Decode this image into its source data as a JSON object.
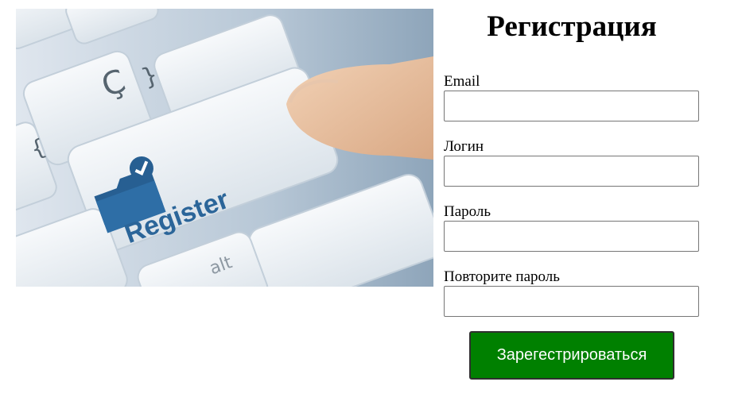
{
  "hero_image": {
    "alt": "Register",
    "key_text": "Register",
    "alt_key_text": "alt"
  },
  "form": {
    "title": "Регистрация",
    "fields": [
      {
        "label": "Email",
        "value": "",
        "type": "email"
      },
      {
        "label": "Логин",
        "value": "",
        "type": "text"
      },
      {
        "label": "Пароль",
        "value": "",
        "type": "password"
      },
      {
        "label": "Повторите пароль",
        "value": "",
        "type": "password"
      }
    ],
    "submit_label": "Зарегестрироваться",
    "submit_color": "#008000"
  }
}
